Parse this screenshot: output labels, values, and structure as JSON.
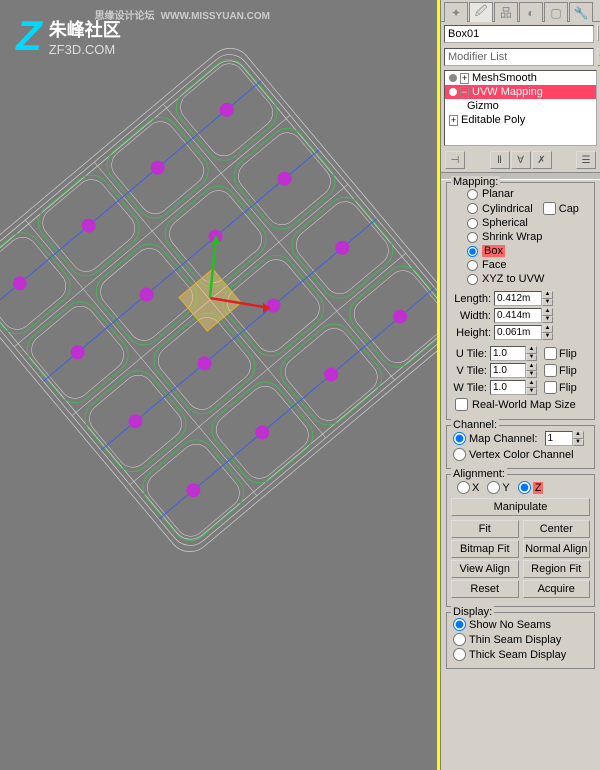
{
  "watermark": {
    "main": "思缘设计论坛",
    "url": "WWW.MISSYUAN.COM"
  },
  "logo": {
    "z": "Z",
    "cn": "朱峰社区",
    "url": "ZF3D.COM"
  },
  "object_name": "Box01",
  "modifier_list_placeholder": "Modifier List",
  "stack": {
    "meshsmooth": "MeshSmooth",
    "uvw": "UVW Mapping",
    "gizmo": "Gizmo",
    "editpoly": "Editable Poly"
  },
  "mapping": {
    "legend": "Mapping:",
    "planar": "Planar",
    "cylindrical": "Cylindrical",
    "cap": "Cap",
    "spherical": "Spherical",
    "shrink": "Shrink Wrap",
    "box": "Box",
    "face": "Face",
    "xyz": "XYZ to UVW",
    "length_label": "Length:",
    "length": "0.412m",
    "width_label": "Width:",
    "width": "0.414m",
    "height_label": "Height:",
    "height": "0.061m",
    "utile_label": "U Tile:",
    "utile": "1.0",
    "vtile_label": "V Tile:",
    "vtile": "1.0",
    "wtile_label": "W Tile:",
    "wtile": "1.0",
    "flip": "Flip",
    "realworld": "Real-World Map Size"
  },
  "channel": {
    "legend": "Channel:",
    "map_channel": "Map Channel:",
    "map_value": "1",
    "vertex_color": "Vertex Color Channel"
  },
  "alignment": {
    "legend": "Alignment:",
    "x": "X",
    "y": "Y",
    "z": "Z",
    "manipulate": "Manipulate",
    "fit": "Fit",
    "center": "Center",
    "bitmap_fit": "Bitmap Fit",
    "normal_align": "Normal Align",
    "view_align": "View Align",
    "region_fit": "Region Fit",
    "reset": "Reset",
    "acquire": "Acquire"
  },
  "display": {
    "legend": "Display:",
    "no_seams": "Show No Seams",
    "thin": "Thin Seam Display",
    "thick": "Thick Seam Display"
  }
}
